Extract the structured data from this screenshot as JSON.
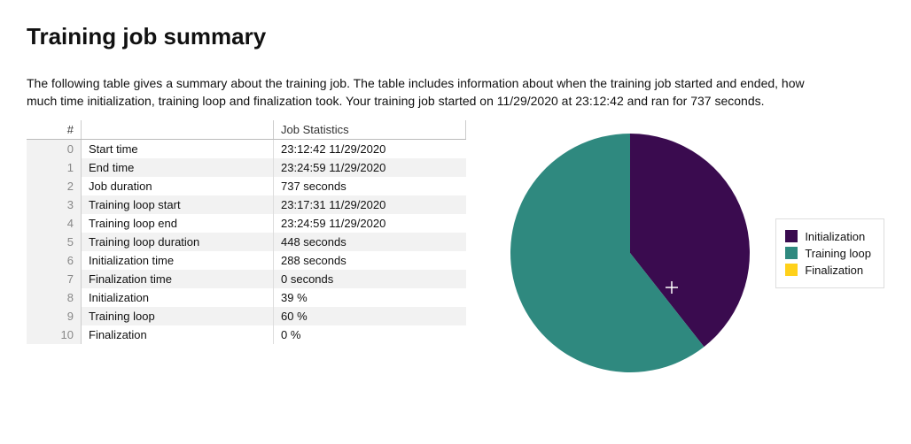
{
  "title": "Training job summary",
  "summary_text": "The following table gives a summary about the training job. The table includes information about when the training job started and ended, how much time initialization, training loop and finalization took. Your training job started on 11/29/2020 at 23:12:42 and ran for 737 seconds.",
  "table": {
    "index_header": "#",
    "name_header": "",
    "value_header": "Job Statistics",
    "rows": [
      {
        "idx": "0",
        "name": "Start time",
        "value": "23:12:42 11/29/2020"
      },
      {
        "idx": "1",
        "name": "End time",
        "value": "23:24:59 11/29/2020"
      },
      {
        "idx": "2",
        "name": "Job duration",
        "value": "737 seconds"
      },
      {
        "idx": "3",
        "name": "Training loop start",
        "value": "23:17:31 11/29/2020"
      },
      {
        "idx": "4",
        "name": "Training loop end",
        "value": "23:24:59 11/29/2020"
      },
      {
        "idx": "5",
        "name": "Training loop duration",
        "value": "448 seconds"
      },
      {
        "idx": "6",
        "name": "Initialization time",
        "value": "288 seconds"
      },
      {
        "idx": "7",
        "name": "Finalization time",
        "value": "0 seconds"
      },
      {
        "idx": "8",
        "name": "Initialization",
        "value": "39 %"
      },
      {
        "idx": "9",
        "name": "Training loop",
        "value": "60 %"
      },
      {
        "idx": "10",
        "name": "Finalization",
        "value": "0 %"
      }
    ]
  },
  "colors": {
    "initialization": "#3a0b4f",
    "training_loop": "#2f897f",
    "finalization": "#ffd11a"
  },
  "legend": {
    "items": [
      {
        "label": "Initialization",
        "color_key": "initialization"
      },
      {
        "label": "Training loop",
        "color_key": "training_loop"
      },
      {
        "label": "Finalization",
        "color_key": "finalization"
      }
    ]
  },
  "chart_data": {
    "type": "pie",
    "title": "",
    "series": [
      {
        "name": "Initialization",
        "value": 39,
        "color": "#3a0b4f"
      },
      {
        "name": "Training loop",
        "value": 60,
        "color": "#2f897f"
      },
      {
        "name": "Finalization",
        "value": 0,
        "color": "#ffd11a"
      }
    ]
  }
}
